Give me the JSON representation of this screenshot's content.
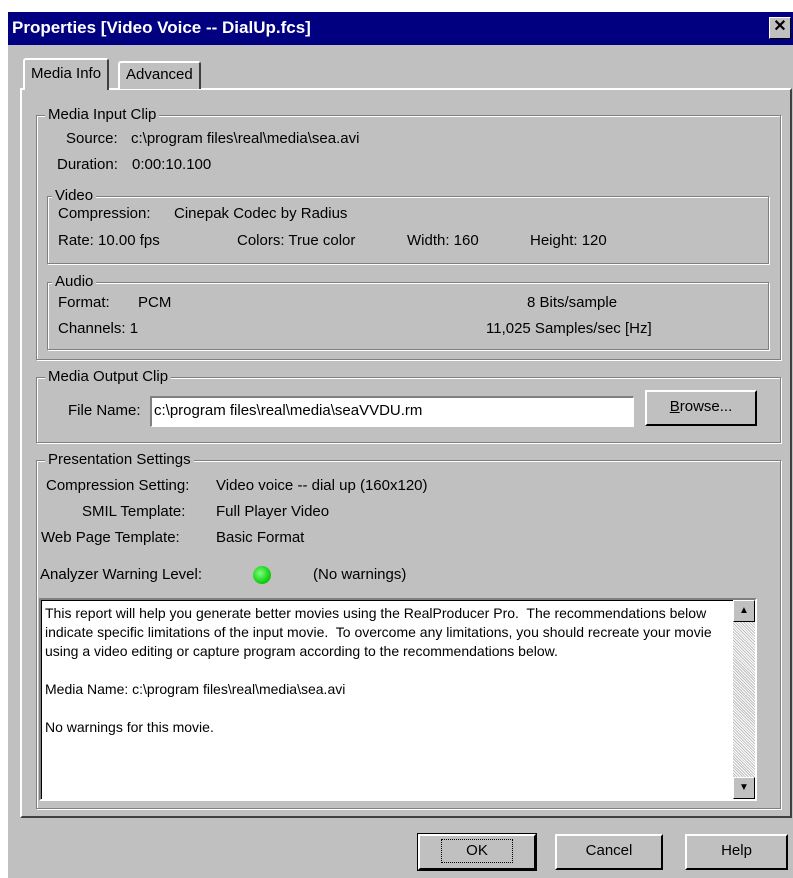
{
  "window": {
    "title": "Properties [Video Voice -- DialUp.fcs]",
    "close_glyph": "✕"
  },
  "tabs": [
    {
      "label": "Media Info",
      "active": true
    },
    {
      "label": "Advanced",
      "active": false
    }
  ],
  "media_input": {
    "group_label": "Media Input Clip",
    "source_label": "Source:",
    "source_value": "c:\\program files\\real\\media\\sea.avi",
    "duration_label": "Duration:",
    "duration_value": "0:00:10.100",
    "video": {
      "group_label": "Video",
      "compression_label": "Compression:",
      "compression_value": "Cinepak Codec by Radius",
      "rate": "Rate:  10.00 fps",
      "colors": "Colors: True color",
      "width": "Width:  160",
      "height": "Height: 120"
    },
    "audio": {
      "group_label": "Audio",
      "format_label": "Format:",
      "format_value": "PCM",
      "bits": "8 Bits/sample",
      "channels": "Channels: 1",
      "samples": "11,025 Samples/sec [Hz]"
    }
  },
  "media_output": {
    "group_label": "Media Output Clip",
    "file_name_label": "File Name:",
    "file_name_value": "c:\\program files\\real\\media\\seaVVDU.rm",
    "browse_accel": "B",
    "browse_rest": "rowse..."
  },
  "presentation": {
    "group_label": "Presentation Settings",
    "compression_label": "Compression Setting:",
    "compression_value": "Video voice -- dial up (160x120)",
    "smil_label": "SMIL Template:",
    "smil_value": "Full Player Video",
    "web_label": "Web Page Template:",
    "web_value": "Basic Format",
    "warning_label": "Analyzer Warning Level:",
    "warning_value": "(No warnings)",
    "warning_color": "#14d214",
    "report_text": "This report will help you generate better movies using the RealProducer Pro.  The recommendations below indicate specific limitations of the input movie.  To overcome any limitations, you should recreate your movie using a video editing or capture program according to the recommendations below.\n\nMedia Name: c:\\program files\\real\\media\\sea.avi\n\nNo warnings for this movie."
  },
  "buttons": {
    "ok": "OK",
    "cancel": "Cancel",
    "help": "Help"
  },
  "icons": {
    "scroll_up": "scroll-up-arrow-icon",
    "scroll_down": "scroll-down-arrow-icon",
    "status": "green-led-icon"
  }
}
